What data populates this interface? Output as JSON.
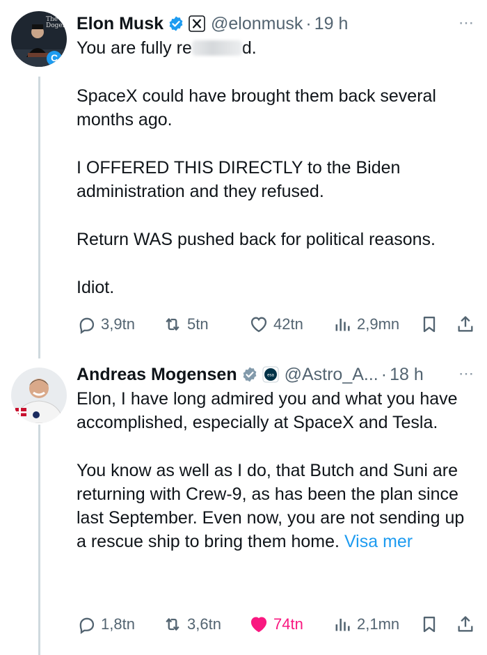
{
  "tweets": [
    {
      "name": "Elon Musk",
      "handle": "@elonmusk",
      "time": "19 h",
      "avatar_text": "The Dogefa",
      "avatar_badge": "C",
      "text_first": "You are fully re",
      "text_first_end": "d.",
      "paragraphs": [
        "SpaceX could have brought them back several months ago.",
        "I OFFERED THIS DIRECTLY to the Biden administration and they refused.",
        "Return WAS pushed back for political reasons.",
        "Idiot."
      ],
      "stats": {
        "replies": "3,9tn",
        "reposts": "5tn",
        "likes": "42tn",
        "views": "2,9mn"
      }
    },
    {
      "name": "Andreas Mogensen",
      "handle": "@Astro_A...",
      "time": "18 h",
      "affiliate_badge": "esa",
      "paragraphs": [
        "Elon, I have long admired you and what you have accomplished, especially at SpaceX and Tesla.",
        "You know as well as I do, that Butch and Suni are returning with Crew-9, as has been the plan since last September. Even now, you are not sending up a rescue ship to bring them home."
      ],
      "show_more": "Visa mer",
      "stats": {
        "replies": "1,8tn",
        "reposts": "3,6tn",
        "likes": "74tn",
        "views": "2,1mn"
      }
    }
  ],
  "more_icon": "⋯",
  "colors": {
    "verified": "#1d9bf0",
    "muted": "#536471",
    "like_active": "#f91880",
    "link": "#1d9bf0"
  },
  "icons": [
    "reply-icon",
    "repost-icon",
    "like-icon",
    "views-icon",
    "bookmark-icon",
    "share-icon",
    "verified-badge-icon",
    "x-affiliate-icon",
    "esa-affiliate-icon"
  ]
}
